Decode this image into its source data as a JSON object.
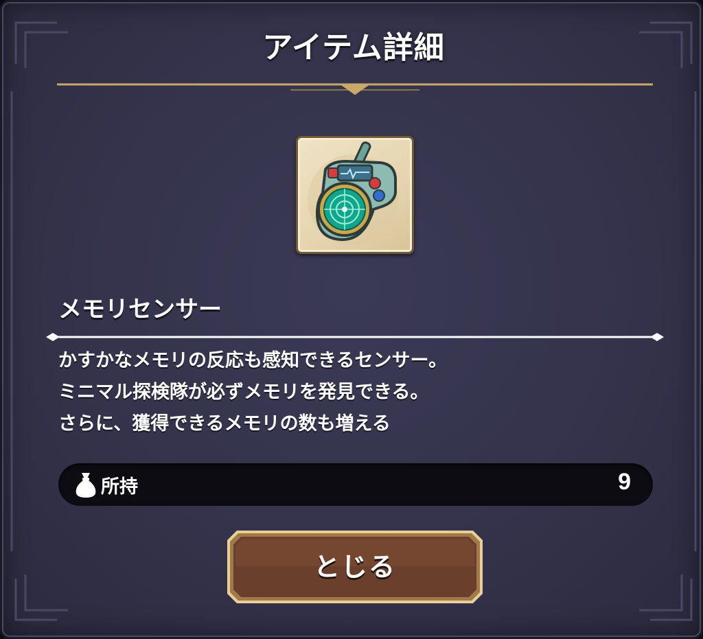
{
  "dialog": {
    "title": "アイテム詳細"
  },
  "item": {
    "icon": "radar-sensor-icon",
    "name": "メモリセンサー",
    "description": [
      "かすかなメモリの反応も感知できるセンサー。",
      "ミニマル探検隊が必ずメモリを発見できる。",
      "さらに、獲得できるメモリの数も増える"
    ]
  },
  "owned": {
    "icon": "money-bag-icon",
    "label": "所持",
    "count": "9"
  },
  "close_button": {
    "label": "とじる"
  },
  "colors": {
    "panel": "#34334b",
    "gold_accent": "#c9a86a",
    "button_brown": "#5a3526",
    "item_frame": "#e5d4ae"
  }
}
